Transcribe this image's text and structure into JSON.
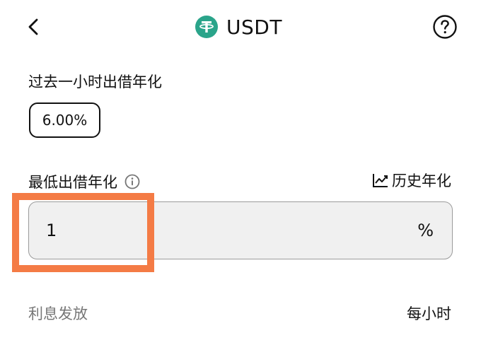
{
  "header": {
    "title": "USDT",
    "back_icon": "chevron-left-icon",
    "coin_icon": "tether-icon",
    "help_icon": "question-circle-icon",
    "coin_color": "#2aa48a"
  },
  "last_hour": {
    "label": "过去一小时出借年化",
    "rate": "6.00%"
  },
  "min_rate": {
    "label": "最低出借年化",
    "info_icon": "info-circle-icon",
    "history_icon": "line-chart-icon",
    "history_label": "历史年化",
    "input_value": "1",
    "unit": "%"
  },
  "interest": {
    "label": "利息发放",
    "value": "每小时"
  },
  "highlight_color": "#f47b45"
}
